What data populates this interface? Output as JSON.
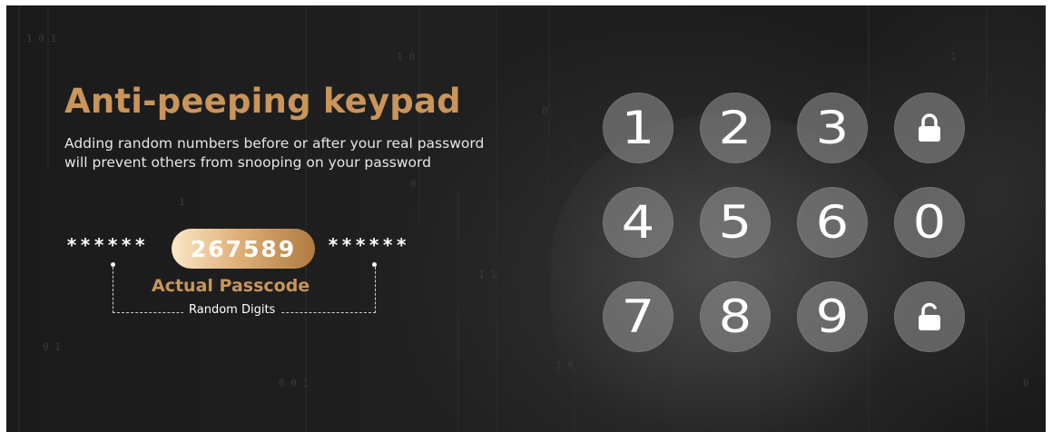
{
  "banner": {
    "title": "Anti-peeping keypad",
    "description_line1": "Adding random numbers before or after your real password",
    "description_line2": "will prevent others from snooping on your password"
  },
  "passcode_demo": {
    "random_prefix": "******",
    "actual_code": "267589",
    "random_suffix": "******",
    "actual_label": "Actual Passcode",
    "random_label": "Random Digits"
  },
  "keypad": {
    "keys": [
      {
        "label": "1"
      },
      {
        "label": "2"
      },
      {
        "label": "3"
      },
      {
        "label": "",
        "icon": "lock-closed-icon"
      },
      {
        "label": "4"
      },
      {
        "label": "5"
      },
      {
        "label": "6"
      },
      {
        "label": "0"
      },
      {
        "label": "7"
      },
      {
        "label": "8"
      },
      {
        "label": "9"
      },
      {
        "label": "",
        "icon": "lock-open-icon"
      }
    ]
  },
  "colors": {
    "accent_gold": "#c9955a",
    "background": "#1b1b1b",
    "key_fill": "#969696",
    "text": "#ffffff"
  }
}
